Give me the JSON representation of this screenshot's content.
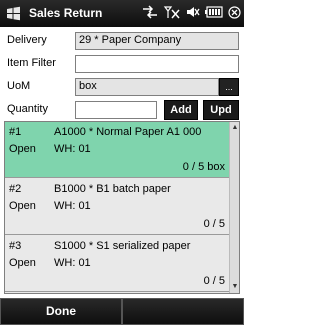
{
  "window": {
    "title": "Sales Return"
  },
  "colors": {
    "bar": "#111111",
    "selected_row": "#7fd4ad",
    "field_bg": "#e4e4e4"
  },
  "form": {
    "delivery_label": "Delivery",
    "delivery_value": "29 * Paper Company",
    "item_filter_label": "Item Filter",
    "item_filter_value": "",
    "uom_label": "UoM",
    "uom_value": "box",
    "uom_button": "...",
    "quantity_label": "Quantity",
    "quantity_value": "",
    "add_button": "Add",
    "upd_button": "Upd"
  },
  "items": [
    {
      "num": "#1",
      "desc": "A1000 * Normal Paper A1 000",
      "state": "Open",
      "wh": "WH: 01",
      "qty": "0 / 5 box",
      "selected": true
    },
    {
      "num": "#2",
      "desc": "B1000 * B1 batch paper",
      "state": "Open",
      "wh": "WH: 01",
      "qty": "0 / 5",
      "selected": false
    },
    {
      "num": "#3",
      "desc": "S1000 * S1 serialized paper",
      "state": "Open",
      "wh": "WH: 01",
      "qty": "0 / 5",
      "selected": false
    }
  ],
  "bottom": {
    "done_label": "Done"
  }
}
